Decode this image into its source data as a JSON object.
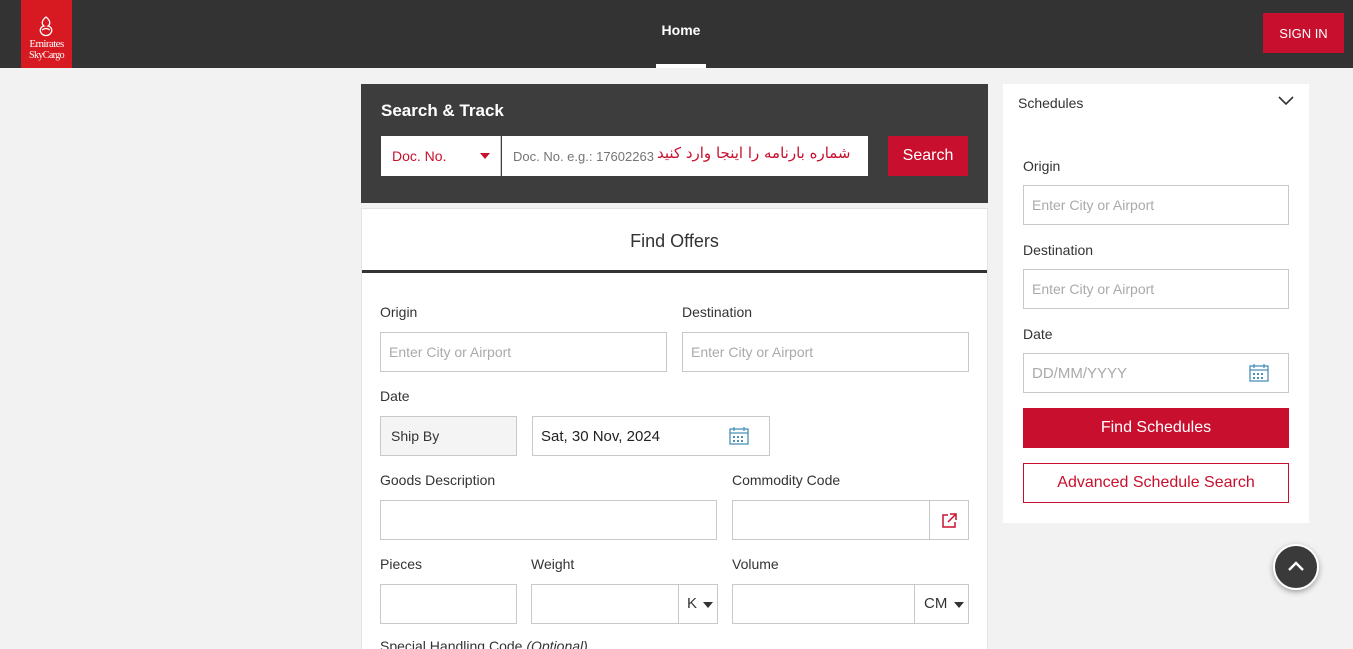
{
  "header": {
    "logo_line1": "Emirates",
    "logo_line2": "SkyCargo",
    "nav_home": "Home",
    "signin_label": "SIGN IN",
    "brand_color": "#c8102e"
  },
  "track": {
    "title": "Search & Track",
    "doc_type": "Doc. No.",
    "doc_placeholder": "Doc. No. e.g.: 17602263",
    "doc_value": "شماره بارنامه را اینجا وارد کنید",
    "search_label": "Search"
  },
  "offers": {
    "tab_label": "Find Offers",
    "origin_label": "Origin",
    "origin_placeholder": "Enter City or Airport",
    "destination_label": "Destination",
    "destination_placeholder": "Enter City or Airport",
    "date_label": "Date",
    "ship_by": "Ship By",
    "date_value": "Sat, 30 Nov, 2024",
    "goods_label": "Goods Description",
    "commodity_label": "Commodity Code",
    "pieces_label": "Pieces",
    "weight_label": "Weight",
    "weight_unit": "K",
    "volume_label": "Volume",
    "volume_unit": "CM",
    "special_label": "Special Handling Code",
    "optional_label": "(Optional)"
  },
  "schedules": {
    "title": "Schedules",
    "origin_label": "Origin",
    "origin_placeholder": "Enter City or Airport",
    "destination_label": "Destination",
    "destination_placeholder": "Enter City or Airport",
    "date_label": "Date",
    "date_placeholder": "DD/MM/YYYY",
    "find_label": "Find Schedules",
    "advanced_label": "Advanced Schedule Search"
  },
  "icons": {
    "calendar": "calendar-icon",
    "external": "external-link-icon",
    "chevron": "chevron-down-icon",
    "top": "arrow-up-icon"
  }
}
